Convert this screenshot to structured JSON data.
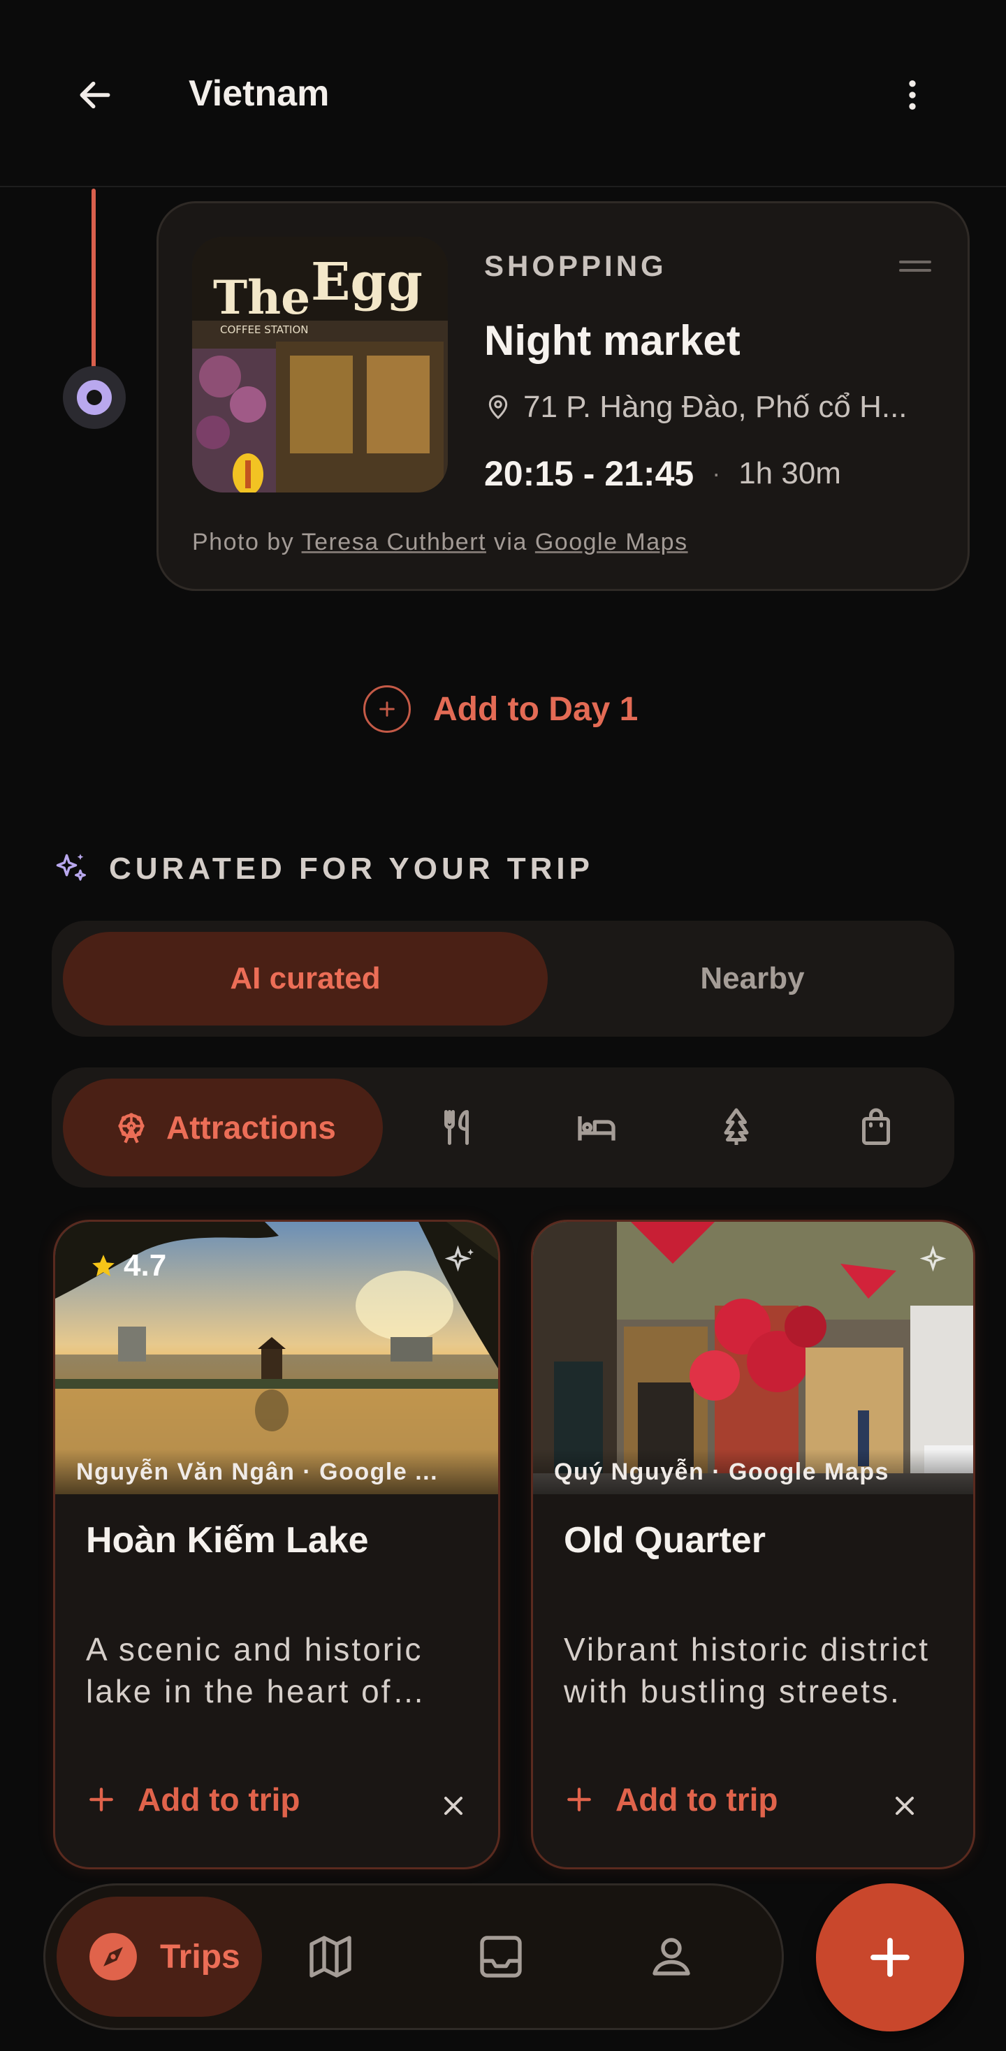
{
  "header": {
    "title": "Vietnam",
    "back_icon": "arrow-left-icon",
    "menu_icon": "more-vertical-icon"
  },
  "activity": {
    "category": "SHOPPING",
    "name": "Night market",
    "address": "71 P. Hàng Đào, Phố cổ H...",
    "time_range": "20:15 - 21:45",
    "separator": "·",
    "duration": "1h 30m",
    "photo_sign": {
      "word1": "The",
      "word2": "Egg",
      "sub": "COFFEE   STATION"
    },
    "credit": {
      "prefix": "Photo by",
      "author": "Teresa Cuthbert",
      "via": "via",
      "source": "Google Maps"
    }
  },
  "add_day": {
    "label": "Add to Day 1"
  },
  "curated": {
    "title": "CURATED FOR YOUR TRIP",
    "tabs": [
      "AI curated",
      "Nearby"
    ],
    "categories": [
      {
        "label": "Attractions",
        "icon": "ferris-wheel-icon",
        "active": true
      },
      {
        "label": "",
        "icon": "fork-knife-icon",
        "active": false
      },
      {
        "label": "",
        "icon": "bed-icon",
        "active": false
      },
      {
        "label": "",
        "icon": "tree-icon",
        "active": false
      },
      {
        "label": "",
        "icon": "shopping-bag-icon",
        "active": false
      }
    ]
  },
  "suggestions": [
    {
      "rating": "4.7",
      "credit": "Nguyễn Văn Ngân · Google ...",
      "name": "Hoàn Kiếm Lake",
      "description": "A scenic and historic lake in the heart of Hanoi.",
      "add_label": "Add to trip"
    },
    {
      "rating": "",
      "credit": "Quý Nguyễn · Google Maps",
      "name": "Old Quarter",
      "description": "Vibrant historic district with bustling streets.",
      "add_label": "Add to trip"
    }
  ],
  "nav": {
    "items": [
      {
        "label": "Trips",
        "icon": "compass-icon",
        "active": true
      },
      {
        "label": "",
        "icon": "map-icon",
        "active": false
      },
      {
        "label": "",
        "icon": "inbox-icon",
        "active": false
      },
      {
        "label": "",
        "icon": "profile-icon",
        "active": false
      }
    ],
    "fab_icon": "plus-icon"
  },
  "colors": {
    "accent": "#e36b55",
    "accent_bg": "#4a2015",
    "timeline": "#d9604d",
    "node": "#b9a8ee",
    "background": "#0b0b0b",
    "card": "#1a1715"
  }
}
